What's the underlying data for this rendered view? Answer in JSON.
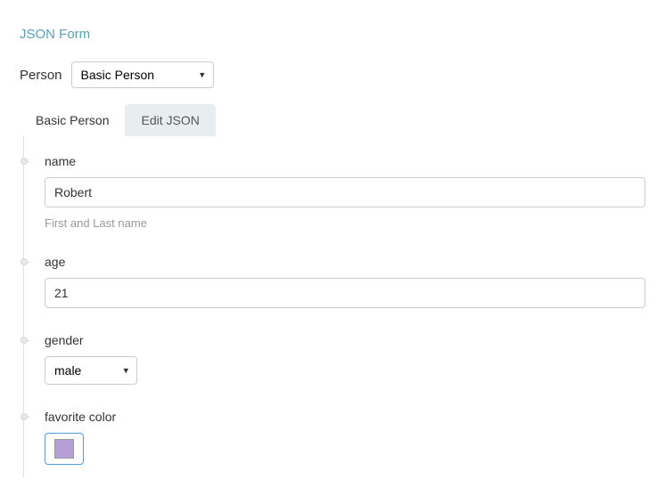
{
  "page_title": "JSON Form",
  "person_selector": {
    "label": "Person",
    "selected": "Basic Person"
  },
  "tabs": {
    "active": "Basic Person",
    "inactive": "Edit JSON"
  },
  "fields": {
    "name": {
      "label": "name",
      "value": "Robert",
      "help": "First and Last name"
    },
    "age": {
      "label": "age",
      "value": "21"
    },
    "gender": {
      "label": "gender",
      "value": "male"
    },
    "favorite_color": {
      "label": "favorite color",
      "value": "#b69fd6"
    }
  }
}
